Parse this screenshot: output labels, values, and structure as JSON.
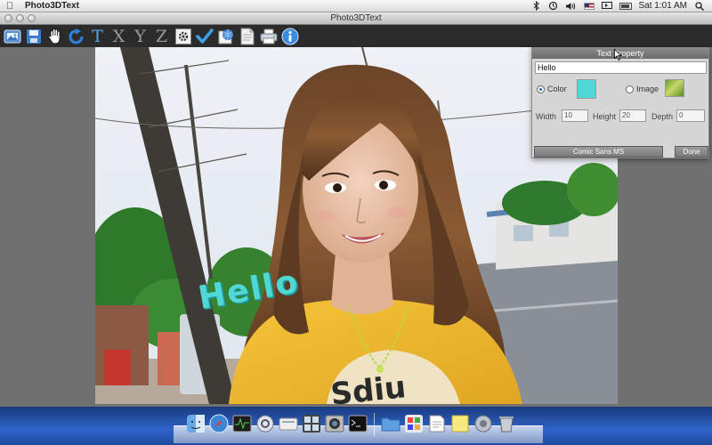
{
  "menubar": {
    "app_name": "Photo3DText",
    "clock": "Sat 1:01 AM"
  },
  "window": {
    "title": "Photo3DText"
  },
  "toolbar": {
    "text_tool_label": "T",
    "axis_x_label": "X",
    "axis_y_label": "Y",
    "axis_z_label": "Z"
  },
  "canvas": {
    "overlay_text": "Hello",
    "overlay_color": "#4fd8d6"
  },
  "text_property": {
    "title": "Text Property",
    "text_value": "Hello",
    "color_label": "Color",
    "image_label": "Image",
    "selected_source": "Color",
    "swatch_color": "#4fd8d6",
    "width_label": "Width",
    "width_value": "10",
    "height_label": "Height",
    "height_value": "20",
    "depth_label": "Depth",
    "depth_value": "0",
    "font_button": "Comic Sans MS",
    "done_button": "Done"
  },
  "dock": {
    "icons": [
      "finder-face-icon",
      "safari-icon",
      "activity-monitor-icon",
      "network-icon",
      "app-icon",
      "exposé-icon",
      "photo-icon",
      "terminal-icon",
      "documents-folder-icon",
      "app-store-icon",
      "preview-icon",
      "stickies-icon",
      "system-icon",
      "trash-icon"
    ]
  }
}
